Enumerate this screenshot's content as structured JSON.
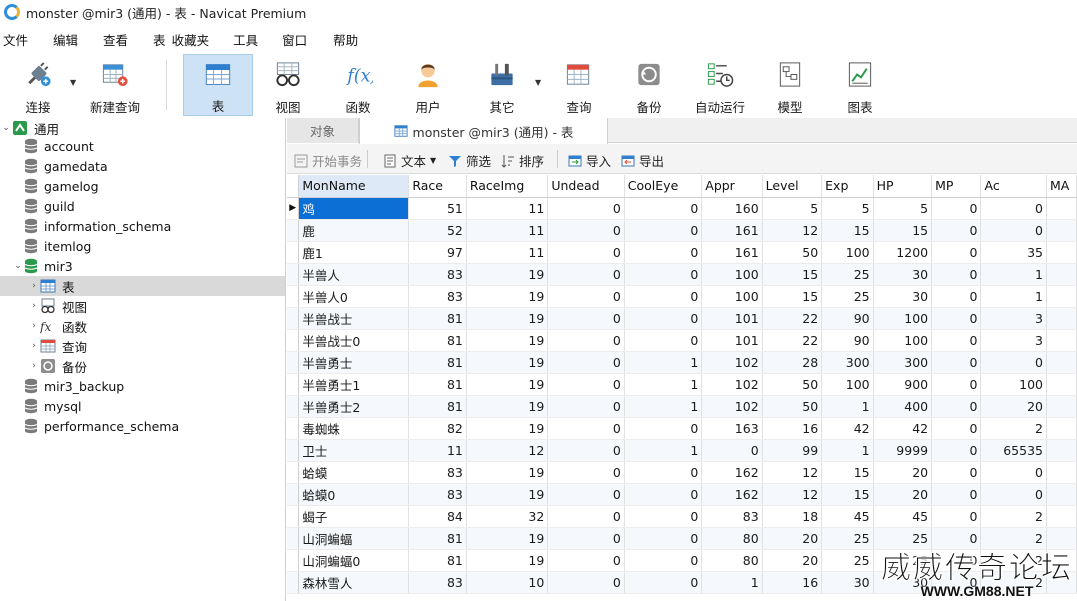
{
  "window": {
    "title": "monster @mir3 (通用) - 表 - Navicat Premium"
  },
  "menu": [
    "文件",
    "编辑",
    "查看",
    "表",
    "收藏夹",
    "工具",
    "窗口",
    "帮助"
  ],
  "toolbar": {
    "connect": "连接",
    "new_query": "新建查询",
    "table": "表",
    "view": "视图",
    "function": "函数",
    "user": "用户",
    "other": "其它",
    "query": "查询",
    "backup": "备份",
    "auto_run": "自动运行",
    "model": "模型",
    "chart": "图表"
  },
  "sidebar": {
    "connection": "通用",
    "databases_top": [
      "account",
      "gamedata",
      "gamelog",
      "guild",
      "information_schema",
      "itemlog"
    ],
    "open_db": "mir3",
    "open_db_children": [
      "表",
      "视图",
      "函数",
      "查询",
      "备份"
    ],
    "databases_bottom": [
      "mir3_backup",
      "mysql",
      "performance_schema"
    ]
  },
  "tabs": {
    "objects": "对象",
    "active": "monster @mir3 (通用) - 表"
  },
  "subtoolbar": {
    "begin_transaction": "开始事务",
    "text": "文本",
    "filter": "筛选",
    "sort": "排序",
    "import": "导入",
    "export": "导出"
  },
  "grid": {
    "columns": [
      "MonName",
      "Race",
      "RaceImg",
      "Undead",
      "CoolEye",
      "Appr",
      "Level",
      "Exp",
      "HP",
      "MP",
      "Ac",
      "MA"
    ],
    "rows": [
      [
        "鸡",
        "51",
        "11",
        "0",
        "0",
        "160",
        "5",
        "5",
        "5",
        "0",
        "0"
      ],
      [
        "鹿",
        "52",
        "11",
        "0",
        "0",
        "161",
        "12",
        "15",
        "15",
        "0",
        "0"
      ],
      [
        "鹿1",
        "97",
        "11",
        "0",
        "0",
        "161",
        "50",
        "100",
        "1200",
        "0",
        "35"
      ],
      [
        "半兽人",
        "83",
        "19",
        "0",
        "0",
        "100",
        "15",
        "25",
        "30",
        "0",
        "1"
      ],
      [
        "半兽人0",
        "83",
        "19",
        "0",
        "0",
        "100",
        "15",
        "25",
        "30",
        "0",
        "1"
      ],
      [
        "半兽战士",
        "81",
        "19",
        "0",
        "0",
        "101",
        "22",
        "90",
        "100",
        "0",
        "3"
      ],
      [
        "半兽战士0",
        "81",
        "19",
        "0",
        "0",
        "101",
        "22",
        "90",
        "100",
        "0",
        "3"
      ],
      [
        "半兽勇士",
        "81",
        "19",
        "0",
        "1",
        "102",
        "28",
        "300",
        "300",
        "0",
        "0"
      ],
      [
        "半兽勇士1",
        "81",
        "19",
        "0",
        "1",
        "102",
        "50",
        "100",
        "900",
        "0",
        "100"
      ],
      [
        "半兽勇士2",
        "81",
        "19",
        "0",
        "1",
        "102",
        "50",
        "1",
        "400",
        "0",
        "20"
      ],
      [
        "毒蜘蛛",
        "82",
        "19",
        "0",
        "0",
        "163",
        "16",
        "42",
        "42",
        "0",
        "2"
      ],
      [
        "卫士",
        "11",
        "12",
        "0",
        "1",
        "0",
        "99",
        "1",
        "9999",
        "0",
        "65535"
      ],
      [
        "蛤蟆",
        "83",
        "19",
        "0",
        "0",
        "162",
        "12",
        "15",
        "20",
        "0",
        "0"
      ],
      [
        "蛤蟆0",
        "83",
        "19",
        "0",
        "0",
        "162",
        "12",
        "15",
        "20",
        "0",
        "0"
      ],
      [
        "蝎子",
        "84",
        "32",
        "0",
        "0",
        "83",
        "18",
        "45",
        "45",
        "0",
        "2"
      ],
      [
        "山洞蝙蝠",
        "81",
        "19",
        "0",
        "0",
        "80",
        "20",
        "25",
        "25",
        "0",
        "2"
      ],
      [
        "山洞蝙蝠0",
        "81",
        "19",
        "0",
        "0",
        "80",
        "20",
        "25",
        "25",
        "0",
        "2"
      ],
      [
        "森林雪人",
        "83",
        "10",
        "0",
        "0",
        "1",
        "16",
        "30",
        "30",
        "0",
        "2"
      ]
    ]
  },
  "watermark": {
    "main": "威威传奇论坛",
    "sub": "WWW.GM88.NET"
  }
}
